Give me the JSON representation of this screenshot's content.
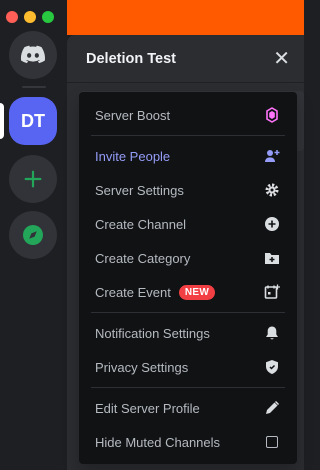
{
  "window": {
    "close_color": "#ff5f57",
    "minimize_color": "#febc2e",
    "zoom_color": "#28c840"
  },
  "servers": {
    "active_initials": "DT"
  },
  "header": {
    "title": "Deletion Test",
    "close_glyph": "✕"
  },
  "menu": {
    "server_boost": "Server Boost",
    "invite_people": "Invite People",
    "server_settings": "Server Settings",
    "create_channel": "Create Channel",
    "create_category": "Create Category",
    "create_event": "Create Event",
    "new_badge": "NEW",
    "notification_settings": "Notification Settings",
    "privacy_settings": "Privacy Settings",
    "edit_server_profile": "Edit Server Profile",
    "hide_muted_channels": "Hide Muted Channels"
  },
  "colors": {
    "brand": "#5865f2",
    "boost": "#ff73fa",
    "invite": "#949cf7",
    "badge": "#f23f43",
    "banner": "#ff5a00"
  }
}
